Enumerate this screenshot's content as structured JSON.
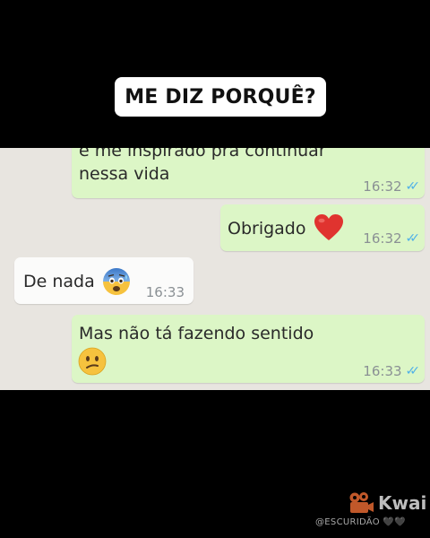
{
  "caption": "ME DIZ PORQUÊ?",
  "messages": [
    {
      "line1": "e me inspirado pra continuar",
      "line2": "nessa vida",
      "time": "16:32",
      "ticks": "✓✓"
    },
    {
      "text": "Obrigado",
      "emoji": "red-heart",
      "time": "16:32",
      "ticks": "✓✓"
    },
    {
      "text": "De nada",
      "emoji": "anxious-face",
      "time": "16:33"
    },
    {
      "line1": "Mas não tá fazendo sentido",
      "emoji": "confused-face",
      "time": "16:33",
      "ticks": "✓✓"
    }
  ],
  "colors": {
    "outgoing_bubble": "#dcf6c6",
    "incoming_bubble": "#fbfbfa",
    "chat_background": "#e8e5e0",
    "read_ticks": "#4fb0e8"
  },
  "watermark": {
    "brand": "Kwai",
    "handle": "@ESCURIDÃO 🖤🖤"
  }
}
